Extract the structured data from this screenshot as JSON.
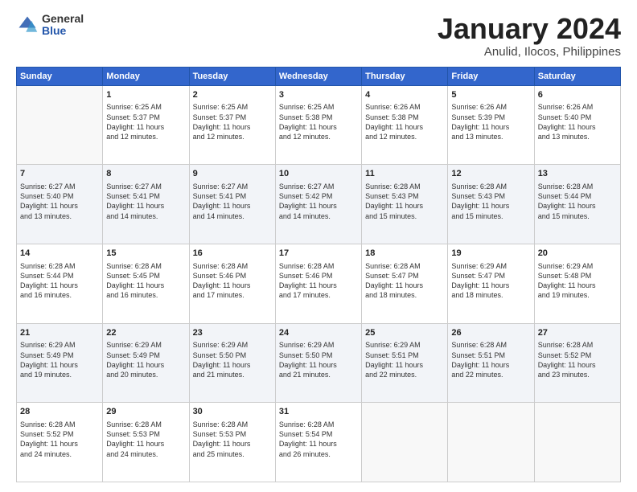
{
  "logo": {
    "general": "General",
    "blue": "Blue"
  },
  "title": {
    "month": "January 2024",
    "location": "Anulid, Ilocos, Philippines"
  },
  "headers": [
    "Sunday",
    "Monday",
    "Tuesday",
    "Wednesday",
    "Thursday",
    "Friday",
    "Saturday"
  ],
  "weeks": [
    [
      {
        "day": "",
        "sunrise": "",
        "sunset": "",
        "daylight": ""
      },
      {
        "day": "1",
        "sunrise": "Sunrise: 6:25 AM",
        "sunset": "Sunset: 5:37 PM",
        "daylight": "Daylight: 11 hours and 12 minutes."
      },
      {
        "day": "2",
        "sunrise": "Sunrise: 6:25 AM",
        "sunset": "Sunset: 5:37 PM",
        "daylight": "Daylight: 11 hours and 12 minutes."
      },
      {
        "day": "3",
        "sunrise": "Sunrise: 6:25 AM",
        "sunset": "Sunset: 5:38 PM",
        "daylight": "Daylight: 11 hours and 12 minutes."
      },
      {
        "day": "4",
        "sunrise": "Sunrise: 6:26 AM",
        "sunset": "Sunset: 5:38 PM",
        "daylight": "Daylight: 11 hours and 12 minutes."
      },
      {
        "day": "5",
        "sunrise": "Sunrise: 6:26 AM",
        "sunset": "Sunset: 5:39 PM",
        "daylight": "Daylight: 11 hours and 13 minutes."
      },
      {
        "day": "6",
        "sunrise": "Sunrise: 6:26 AM",
        "sunset": "Sunset: 5:40 PM",
        "daylight": "Daylight: 11 hours and 13 minutes."
      }
    ],
    [
      {
        "day": "7",
        "sunrise": "Sunrise: 6:27 AM",
        "sunset": "Sunset: 5:40 PM",
        "daylight": "Daylight: 11 hours and 13 minutes."
      },
      {
        "day": "8",
        "sunrise": "Sunrise: 6:27 AM",
        "sunset": "Sunset: 5:41 PM",
        "daylight": "Daylight: 11 hours and 14 minutes."
      },
      {
        "day": "9",
        "sunrise": "Sunrise: 6:27 AM",
        "sunset": "Sunset: 5:41 PM",
        "daylight": "Daylight: 11 hours and 14 minutes."
      },
      {
        "day": "10",
        "sunrise": "Sunrise: 6:27 AM",
        "sunset": "Sunset: 5:42 PM",
        "daylight": "Daylight: 11 hours and 14 minutes."
      },
      {
        "day": "11",
        "sunrise": "Sunrise: 6:28 AM",
        "sunset": "Sunset: 5:43 PM",
        "daylight": "Daylight: 11 hours and 15 minutes."
      },
      {
        "day": "12",
        "sunrise": "Sunrise: 6:28 AM",
        "sunset": "Sunset: 5:43 PM",
        "daylight": "Daylight: 11 hours and 15 minutes."
      },
      {
        "day": "13",
        "sunrise": "Sunrise: 6:28 AM",
        "sunset": "Sunset: 5:44 PM",
        "daylight": "Daylight: 11 hours and 15 minutes."
      }
    ],
    [
      {
        "day": "14",
        "sunrise": "Sunrise: 6:28 AM",
        "sunset": "Sunset: 5:44 PM",
        "daylight": "Daylight: 11 hours and 16 minutes."
      },
      {
        "day": "15",
        "sunrise": "Sunrise: 6:28 AM",
        "sunset": "Sunset: 5:45 PM",
        "daylight": "Daylight: 11 hours and 16 minutes."
      },
      {
        "day": "16",
        "sunrise": "Sunrise: 6:28 AM",
        "sunset": "Sunset: 5:46 PM",
        "daylight": "Daylight: 11 hours and 17 minutes."
      },
      {
        "day": "17",
        "sunrise": "Sunrise: 6:28 AM",
        "sunset": "Sunset: 5:46 PM",
        "daylight": "Daylight: 11 hours and 17 minutes."
      },
      {
        "day": "18",
        "sunrise": "Sunrise: 6:28 AM",
        "sunset": "Sunset: 5:47 PM",
        "daylight": "Daylight: 11 hours and 18 minutes."
      },
      {
        "day": "19",
        "sunrise": "Sunrise: 6:29 AM",
        "sunset": "Sunset: 5:47 PM",
        "daylight": "Daylight: 11 hours and 18 minutes."
      },
      {
        "day": "20",
        "sunrise": "Sunrise: 6:29 AM",
        "sunset": "Sunset: 5:48 PM",
        "daylight": "Daylight: 11 hours and 19 minutes."
      }
    ],
    [
      {
        "day": "21",
        "sunrise": "Sunrise: 6:29 AM",
        "sunset": "Sunset: 5:49 PM",
        "daylight": "Daylight: 11 hours and 19 minutes."
      },
      {
        "day": "22",
        "sunrise": "Sunrise: 6:29 AM",
        "sunset": "Sunset: 5:49 PM",
        "daylight": "Daylight: 11 hours and 20 minutes."
      },
      {
        "day": "23",
        "sunrise": "Sunrise: 6:29 AM",
        "sunset": "Sunset: 5:50 PM",
        "daylight": "Daylight: 11 hours and 21 minutes."
      },
      {
        "day": "24",
        "sunrise": "Sunrise: 6:29 AM",
        "sunset": "Sunset: 5:50 PM",
        "daylight": "Daylight: 11 hours and 21 minutes."
      },
      {
        "day": "25",
        "sunrise": "Sunrise: 6:29 AM",
        "sunset": "Sunset: 5:51 PM",
        "daylight": "Daylight: 11 hours and 22 minutes."
      },
      {
        "day": "26",
        "sunrise": "Sunrise: 6:28 AM",
        "sunset": "Sunset: 5:51 PM",
        "daylight": "Daylight: 11 hours and 22 minutes."
      },
      {
        "day": "27",
        "sunrise": "Sunrise: 6:28 AM",
        "sunset": "Sunset: 5:52 PM",
        "daylight": "Daylight: 11 hours and 23 minutes."
      }
    ],
    [
      {
        "day": "28",
        "sunrise": "Sunrise: 6:28 AM",
        "sunset": "Sunset: 5:52 PM",
        "daylight": "Daylight: 11 hours and 24 minutes."
      },
      {
        "day": "29",
        "sunrise": "Sunrise: 6:28 AM",
        "sunset": "Sunset: 5:53 PM",
        "daylight": "Daylight: 11 hours and 24 minutes."
      },
      {
        "day": "30",
        "sunrise": "Sunrise: 6:28 AM",
        "sunset": "Sunset: 5:53 PM",
        "daylight": "Daylight: 11 hours and 25 minutes."
      },
      {
        "day": "31",
        "sunrise": "Sunrise: 6:28 AM",
        "sunset": "Sunset: 5:54 PM",
        "daylight": "Daylight: 11 hours and 26 minutes."
      },
      {
        "day": "",
        "sunrise": "",
        "sunset": "",
        "daylight": ""
      },
      {
        "day": "",
        "sunrise": "",
        "sunset": "",
        "daylight": ""
      },
      {
        "day": "",
        "sunrise": "",
        "sunset": "",
        "daylight": ""
      }
    ]
  ]
}
